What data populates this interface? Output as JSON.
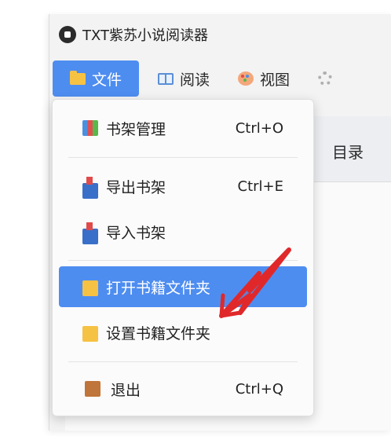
{
  "window": {
    "title": "TXT紫苏小说阅读器"
  },
  "menubar": {
    "tabs": [
      {
        "label": "文件",
        "icon": "folder-icon",
        "active": true
      },
      {
        "label": "阅读",
        "icon": "book-icon",
        "active": false
      },
      {
        "label": "视图",
        "icon": "palette-icon",
        "active": false
      },
      {
        "label": "",
        "icon": "gear-icon",
        "active": false
      }
    ]
  },
  "content": {
    "toc_label": "目录"
  },
  "file_menu": {
    "items": [
      {
        "label": "书架管理",
        "shortcut": "Ctrl+O",
        "icon": "bookshelf-icon"
      },
      {
        "label": "导出书架",
        "shortcut": "Ctrl+E",
        "icon": "export-icon"
      },
      {
        "label": "导入书架",
        "shortcut": "",
        "icon": "import-icon"
      },
      {
        "label": "打开书籍文件夹",
        "shortcut": "",
        "icon": "folder-icon",
        "highlighted": true
      },
      {
        "label": "设置书籍文件夹",
        "shortcut": "",
        "icon": "folder-icon"
      },
      {
        "label": "退出",
        "shortcut": "Ctrl+Q",
        "icon": "exit-door-icon"
      }
    ]
  },
  "colors": {
    "accent": "#4e8df0",
    "annotation_arrow": "#e0282a"
  }
}
